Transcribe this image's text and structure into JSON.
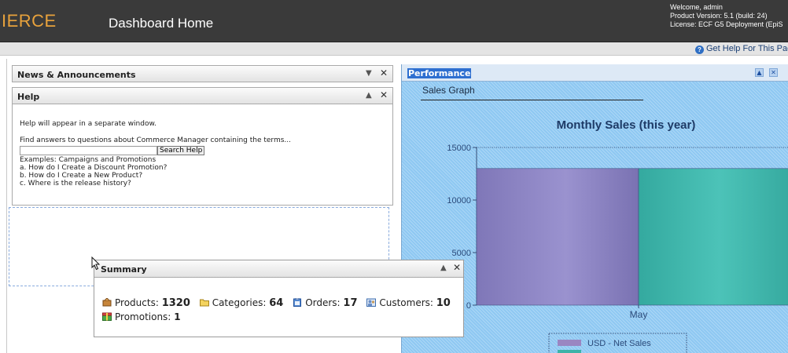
{
  "header": {
    "brand": "IERCE",
    "title": "Dashboard Home",
    "welcome": "Welcome, admin",
    "product_version": "Product Version: 5.1 (build: 24)",
    "license": "License: ECF G5 Deployment (EpiS"
  },
  "help_link": "Get Help For This Pag",
  "portlets": {
    "news": {
      "title": "News & Announcements"
    },
    "help": {
      "title": "Help",
      "intro": "Help will appear in a separate window.",
      "find_text": "Find answers to questions about Commerce Manager containing the terms...",
      "search_value": "",
      "search_button": "Search Help",
      "examples_label": "Examples: Campaigns and Promotions",
      "examples": [
        "a.  How do I Create a Discount Promotion?",
        "b.  How do I Create a New Product?",
        "c.  Where is the release history?"
      ]
    },
    "performance": {
      "title": "Performance",
      "graph_label": "Sales Graph"
    },
    "summary": {
      "title": "Summary",
      "products_label": "Products:",
      "products_value": "1320",
      "categories_label": "Categories:",
      "categories_value": "64",
      "orders_label": "Orders:",
      "orders_value": "17",
      "customers_label": "Customers:",
      "customers_value": "10",
      "promotions_label": "Promotions:",
      "promotions_value": "1"
    }
  },
  "icons": {
    "help": "question-circle-icon",
    "collapse": "collapse-arrow-icon",
    "close": "close-icon",
    "products": "product-box-icon",
    "categories": "folder-icon",
    "orders": "clipboard-icon",
    "customers": "customers-icon",
    "promotions": "promotion-icon"
  },
  "colors": {
    "brand_orange": "#e8a23c",
    "performance_bg": "#8ec8f2",
    "net_sales": "#8e86c4",
    "series2": "#3db3a8",
    "highlight_title": "#2e6fd0"
  },
  "chart_data": {
    "type": "bar",
    "title": "Monthly Sales (this year)",
    "categories": [
      "May"
    ],
    "series": [
      {
        "name": "USD - Net Sales",
        "values": [
          13000
        ]
      },
      {
        "name": "",
        "values": [
          13000
        ]
      }
    ],
    "ylim": [
      0,
      15000
    ],
    "yticks": [
      0,
      5000,
      10000,
      15000
    ],
    "xlabel": "",
    "ylabel": "",
    "grid": true,
    "legend_position": "bottom"
  }
}
